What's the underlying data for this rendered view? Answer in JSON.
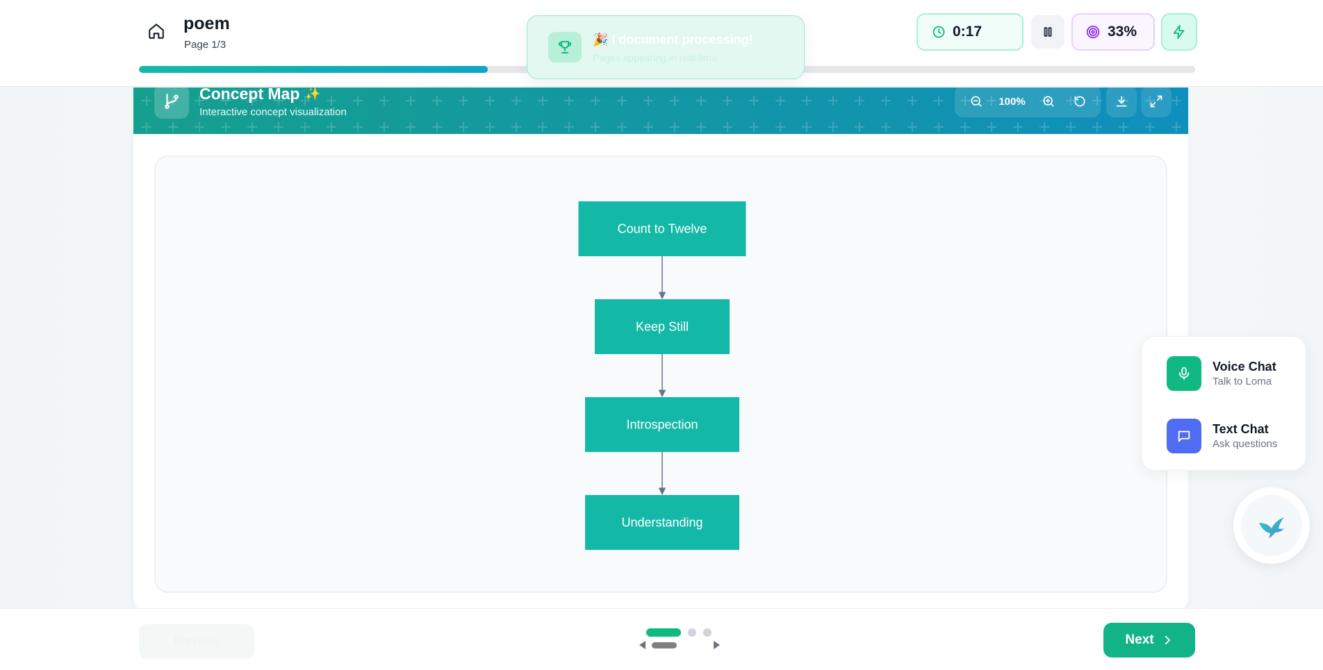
{
  "header": {
    "doc_title": "poem",
    "page_label": "Page 1/3",
    "progress_fraction": 0.33,
    "timer": "0:17",
    "focus_percent": "33%"
  },
  "toast": {
    "emoji": "🎉",
    "title": "l document processing!",
    "subtitle": "Pages appearing in real-time"
  },
  "concept_map": {
    "title": "Concept Map",
    "sparkle": "✨",
    "subtitle": "Interactive concept visualization",
    "zoom_level": "100%",
    "nodes": [
      {
        "label": "Count to Twelve"
      },
      {
        "label": "Keep Still"
      },
      {
        "label": "Introspection"
      },
      {
        "label": "Understanding"
      }
    ],
    "edges": [
      [
        0,
        1
      ],
      [
        1,
        2
      ],
      [
        2,
        3
      ]
    ],
    "node_color": "#14b8a6",
    "edge_color": "#64748b"
  },
  "chat_panel": {
    "voice": {
      "title": "Voice Chat",
      "subtitle": "Talk to Loma",
      "color": "#10b981"
    },
    "text": {
      "title": "Text Chat",
      "subtitle": "Ask questions",
      "color": "#4f6cf2"
    }
  },
  "footer": {
    "prev_label": "Previous",
    "next_label": "Next",
    "page_dots": 3,
    "active_page": 1
  },
  "colors": {
    "accent": "#12b386",
    "header_gradient_start": "#159f8e",
    "header_gradient_end": "#0f8fbc"
  },
  "icons": [
    "home-icon",
    "clock-icon",
    "pause-icon",
    "target-icon",
    "bolt-icon",
    "trophy-icon",
    "git-branch-icon",
    "zoom-out-icon",
    "zoom-in-icon",
    "reset-icon",
    "download-icon",
    "fullscreen-icon",
    "microphone-icon",
    "message-icon",
    "bird-icon",
    "chevron-right-icon"
  ]
}
